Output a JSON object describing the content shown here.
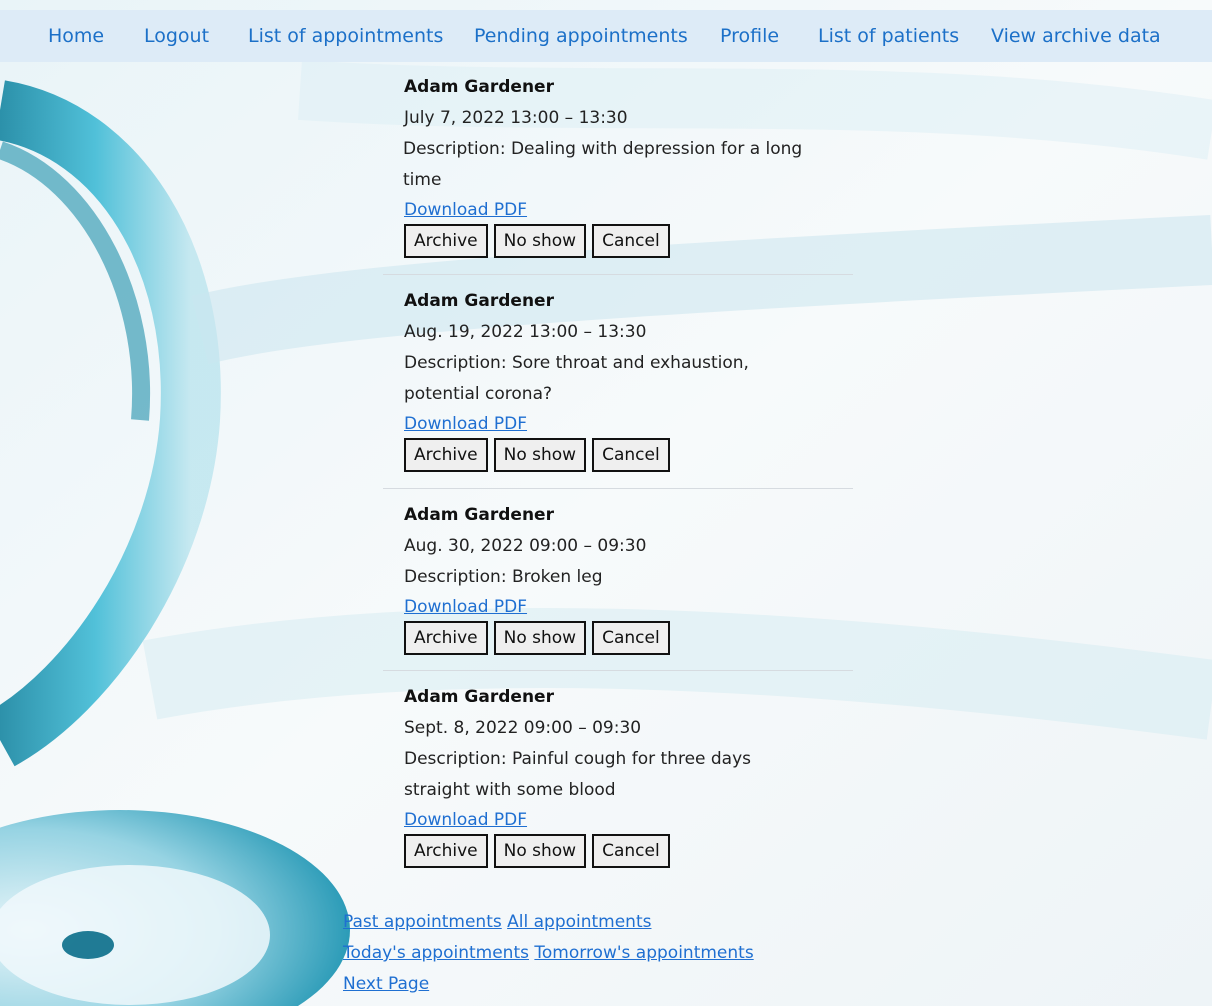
{
  "nav": {
    "items": [
      "Home",
      "Logout",
      "List of appointments",
      "Pending appointments",
      "Profile",
      "List of patients",
      "View archive data"
    ]
  },
  "appointments": [
    {
      "patient": "Adam Gardener",
      "datetime": "July 7, 2022 13:00 – 13:30",
      "description": "Description: Dealing with depression for a long time",
      "pdf_link": "Download PDF",
      "actions": [
        "Archive",
        "No show",
        "Cancel"
      ]
    },
    {
      "patient": "Adam Gardener",
      "datetime": "Aug. 19, 2022 13:00 – 13:30",
      "description": "Description: Sore throat and exhaustion, potential corona?",
      "pdf_link": "Download PDF",
      "actions": [
        "Archive",
        "No show",
        "Cancel"
      ]
    },
    {
      "patient": "Adam Gardener",
      "datetime": "Aug. 30, 2022 09:00 – 09:30",
      "description": "Description: Broken leg",
      "pdf_link": "Download PDF",
      "actions": [
        "Archive",
        "No show",
        "Cancel"
      ]
    },
    {
      "patient": "Adam Gardener",
      "datetime": "Sept. 8, 2022 09:00 – 09:30",
      "description": "Description: Painful cough for three days straight with some blood",
      "pdf_link": "Download PDF",
      "actions": [
        "Archive",
        "No show",
        "Cancel"
      ]
    }
  ],
  "footer": {
    "past": "Past appointments",
    "all": "All appointments",
    "today": "Today's appointments",
    "tomorrow": "Tomorrow's appointments",
    "next": "Next Page"
  },
  "colors": {
    "nav_bg": "#ddebf7",
    "link": "#1f6fd1",
    "accent_teal": "#2aa9c6"
  }
}
